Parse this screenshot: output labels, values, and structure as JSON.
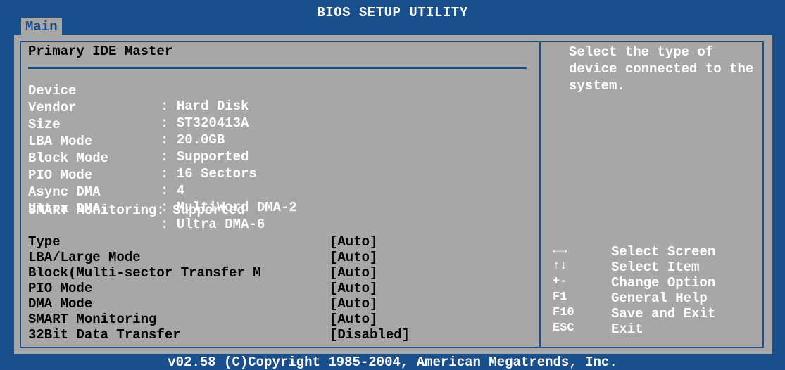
{
  "window": {
    "title": "BIOS SETUP UTILITY",
    "tabs": [
      {
        "label": "Main"
      }
    ]
  },
  "main": {
    "section_title": "Primary IDE Master",
    "device_info": [
      {
        "label": "Device",
        "value": ": Hard Disk"
      },
      {
        "label": "Vendor",
        "value": ": ST320413A"
      },
      {
        "label": "Size",
        "value": ": 20.0GB"
      },
      {
        "label": "LBA Mode",
        "value": ": Supported"
      },
      {
        "label": "Block Mode",
        "value": ": 16 Sectors"
      },
      {
        "label": "PIO Mode",
        "value": ": 4"
      },
      {
        "label": "Async DMA",
        "value": ": MultiWord DMA-2"
      },
      {
        "label": "Ultra DMA",
        "value": ": Ultra DMA-6"
      }
    ],
    "smart_info": "SMART Monitoring: Supported",
    "settings": [
      {
        "label": "Type",
        "value": "[Auto]"
      },
      {
        "label": "LBA/Large Mode",
        "value": "[Auto]"
      },
      {
        "label": "Block(Multi-sector Transfer M",
        "value": "[Auto]"
      },
      {
        "label": "PIO Mode",
        "value": "[Auto]"
      },
      {
        "label": "DMA Mode",
        "value": "[Auto]"
      },
      {
        "label": "SMART Monitoring",
        "value": "[Auto]"
      },
      {
        "label": "32Bit Data Transfer",
        "value": "[Disabled]"
      }
    ]
  },
  "help": {
    "text": "Select the type of device connected to the system.",
    "keys": [
      {
        "key": "←→",
        "description": "Select Screen"
      },
      {
        "key": "↑↓",
        "description": "Select Item"
      },
      {
        "key": "+-",
        "description": "Change Option"
      },
      {
        "key": "F1",
        "description": "General Help"
      },
      {
        "key": "F10",
        "description": "Save and Exit"
      },
      {
        "key": "ESC",
        "description": "Exit"
      }
    ]
  },
  "footer": {
    "text": "v02.58 (C)Copyright 1985-2004, American Megatrends, Inc."
  },
  "colors": {
    "background": "#1a4f8d",
    "panel": "#a7a7a7",
    "info_text": "#ffffff",
    "setting_text": "#000000"
  }
}
